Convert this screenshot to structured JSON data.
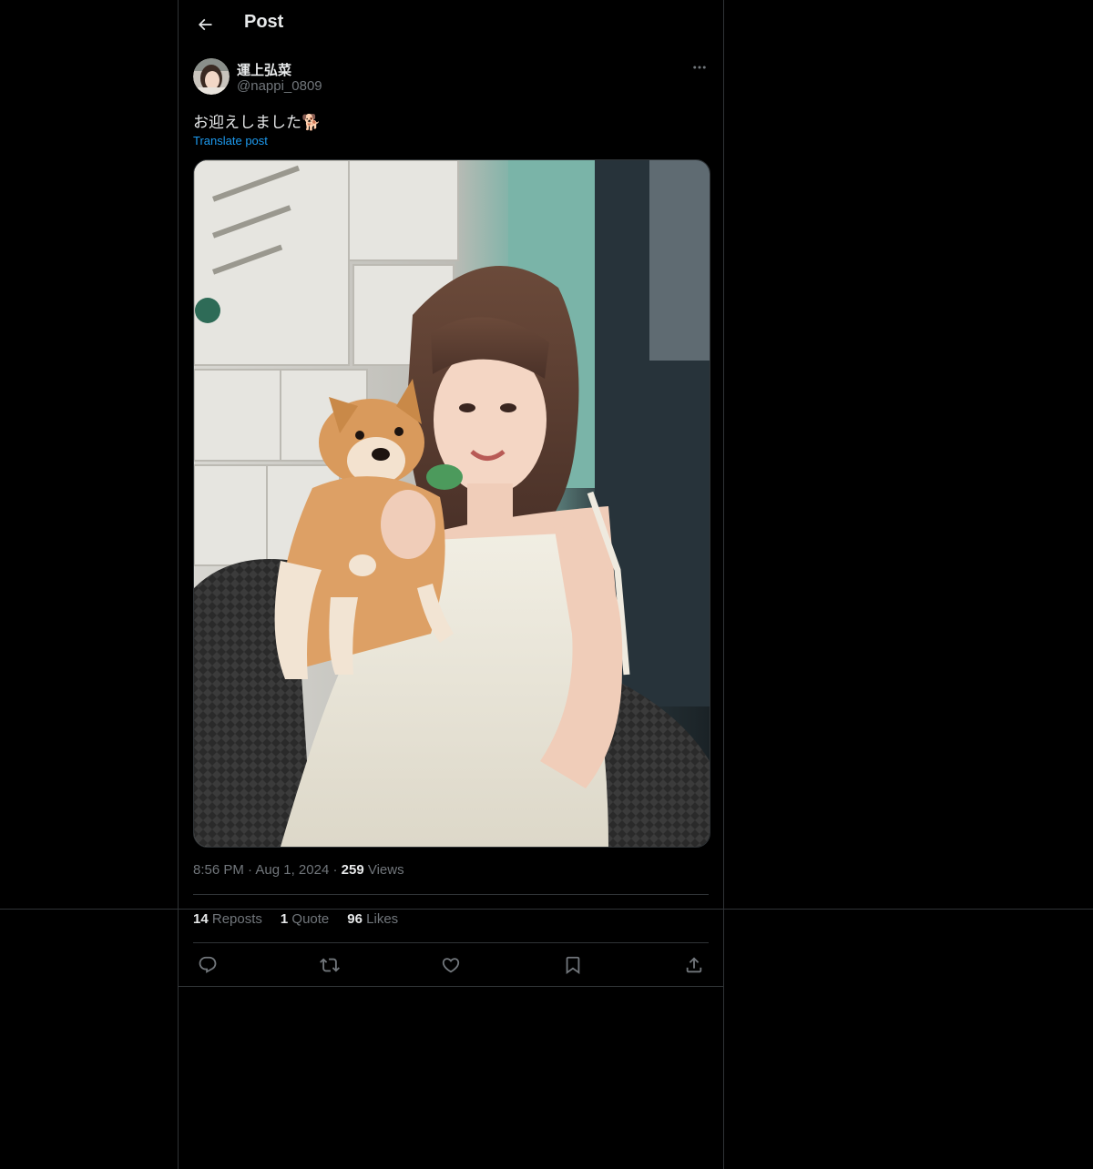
{
  "header": {
    "title": "Post"
  },
  "author": {
    "name": "運上弘菜",
    "handle": "@nappi_0809"
  },
  "post": {
    "text": "お迎えしました🐕",
    "translate_label": "Translate post"
  },
  "meta": {
    "time": "8:56 PM",
    "date": "Aug 1, 2024",
    "views_count": "259",
    "views_label": "Views"
  },
  "stats": {
    "reposts_count": "14",
    "reposts_label": "Reposts",
    "quotes_count": "1",
    "quotes_label": "Quote",
    "likes_count": "96",
    "likes_label": "Likes"
  },
  "icons": {
    "back": "arrow-left-icon",
    "more": "ellipsis-icon",
    "reply": "reply-icon",
    "repost": "repost-icon",
    "like": "heart-icon",
    "bookmark": "bookmark-icon",
    "share": "share-icon"
  },
  "colors": {
    "background": "#000000",
    "text": "#e7e9ea",
    "muted": "#71767b",
    "link": "#1d9bf0",
    "border": "#2f3336"
  }
}
